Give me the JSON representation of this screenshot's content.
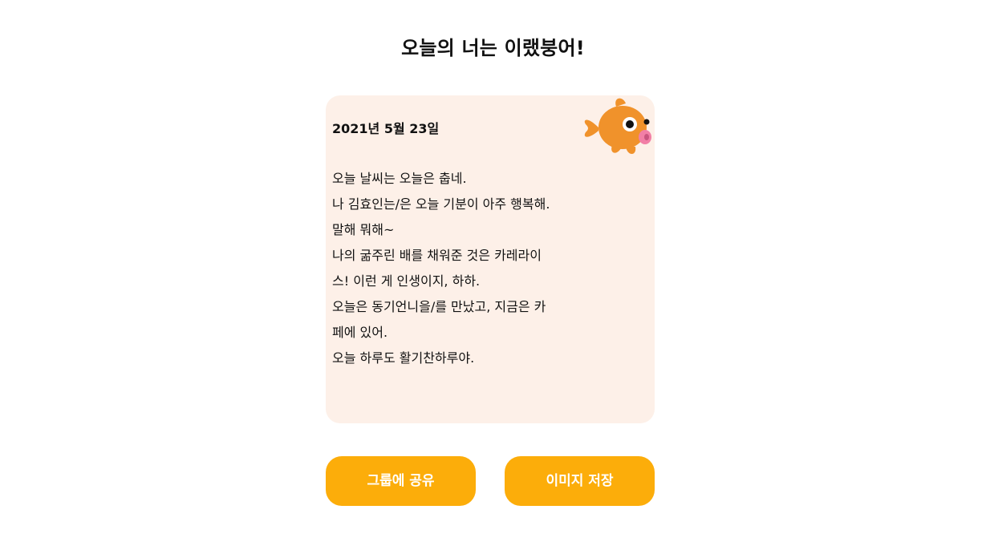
{
  "header": {
    "title": "오늘의 너는 이랬붕어!"
  },
  "diary": {
    "date": "2021년 5월 23일",
    "lines": [
      "오늘 날씨는 오늘은 춥네.",
      "나 김효인는/은 오늘 기분이 아주 행복해.",
      "말해 뭐해~",
      "나의 굶주린 배를 채워준 것은 카레라이",
      "스! 이런 게 인생이지, 하하.",
      "오늘은 동기언니을/를 만났고, 지금은 카",
      "페에 있어.",
      "오늘 하루도 활기찬하루야."
    ],
    "mascot_icon": "goldfish-icon"
  },
  "actions": {
    "share_label": "그룹에 공유",
    "save_label": "이미지 저장"
  },
  "colors": {
    "card_background": "#fdf0e8",
    "button_background": "#fcad0a",
    "button_text": "#ffffff",
    "fish_body": "#f0922b",
    "fish_mouth": "#f27fa6"
  }
}
